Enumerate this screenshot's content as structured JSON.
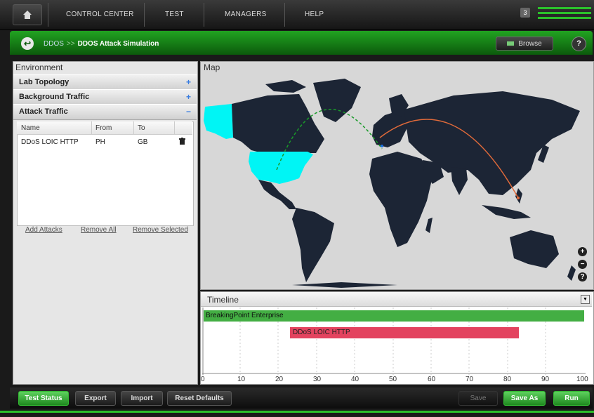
{
  "nav": {
    "items": [
      "CONTROL CENTER",
      "TEST",
      "MANAGERS",
      "HELP"
    ],
    "notification_count": "3"
  },
  "header": {
    "breadcrumb_parent": "DDOS",
    "breadcrumb_separator": ">>",
    "breadcrumb_current": "DDOS Attack Simulation",
    "browse_label": "Browse",
    "help_label": "?"
  },
  "environment": {
    "title": "Environment",
    "sections": [
      {
        "label": "Lab Topology",
        "state": "+"
      },
      {
        "label": "Background Traffic",
        "state": "+"
      },
      {
        "label": "Attack Traffic",
        "state": "−"
      }
    ],
    "table": {
      "columns": [
        "Name",
        "From",
        "To"
      ],
      "rows": [
        {
          "name": "DDoS LOIC HTTP",
          "from": "PH",
          "to": "GB"
        }
      ]
    },
    "links": {
      "add": "Add Attacks",
      "remove_all": "Remove All",
      "remove_selected": "Remove Selected"
    }
  },
  "map": {
    "title": "Map",
    "highlight_color": "#00f5f5",
    "land_color": "#1c2535",
    "sea_color": "#d7d7d7",
    "arc_colors": {
      "background": "#1a9a2a",
      "attack": "#e06a3a"
    }
  },
  "timeline": {
    "title": "Timeline",
    "bars": [
      {
        "label": "BreakingPoint Enterprise",
        "start": 0,
        "end": 100,
        "color": "#43ae43"
      },
      {
        "label": "DDoS LOIC HTTP",
        "start": 23,
        "end": 83,
        "color": "#e3435f"
      }
    ],
    "ticks": [
      "0",
      "10",
      "20",
      "30",
      "40",
      "50",
      "60",
      "70",
      "80",
      "90",
      "100"
    ]
  },
  "bottom": {
    "test_status": "Test Status",
    "export": "Export",
    "import": "Import",
    "reset": "Reset Defaults",
    "save": "Save",
    "save_as": "Save As",
    "run": "Run"
  }
}
